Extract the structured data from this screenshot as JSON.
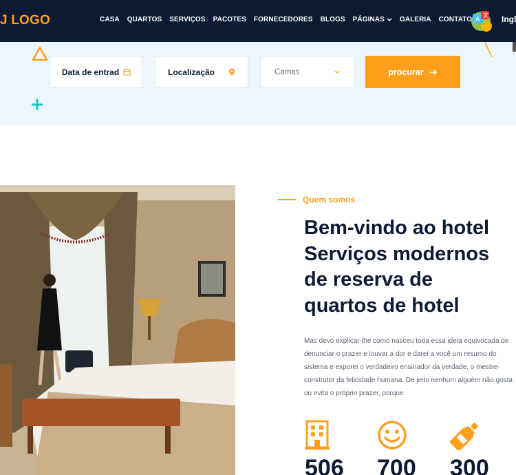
{
  "header": {
    "logo": "J LOGO",
    "nav": [
      {
        "label": "CASA"
      },
      {
        "label": "QUARTOS"
      },
      {
        "label": "SERVIÇOS"
      },
      {
        "label": "PACOTES"
      },
      {
        "label": "FORNECEDORES"
      },
      {
        "label": "BLOGS"
      },
      {
        "label": "PÁGINAS"
      },
      {
        "label": "GALERIA"
      },
      {
        "label": "CONTATO"
      }
    ],
    "language": "Ingl"
  },
  "booking": {
    "date_label": "Data de entrad",
    "location_label": "Localização",
    "beds_placeholder": "Camas",
    "search_label": "procurar"
  },
  "about": {
    "eyebrow": "Quem somos",
    "title_lines": [
      "Bem-vindo ao hotel",
      "Serviços modernos",
      "de reserva de",
      "quartos de hotel"
    ],
    "description": "Mas devo explicar-lhe como nasceu toda essa ideia equivocada de denunciar o prazer e louvar a dor e darei a você um resumo do sistema e exporei o verdadeiro ensinador da verdade, o mestre-construtor da felicidade humana. De jeito nenhum alguém não gosta ou evita o próprio prazer, porque"
  },
  "stats": [
    {
      "icon": "building-icon",
      "value": "506"
    },
    {
      "icon": "smiley-icon",
      "value": "700"
    },
    {
      "icon": "bottle-icon",
      "value": "300"
    }
  ],
  "colors": {
    "accent": "#ff9f1c",
    "navy": "#0d1a33",
    "band": "#eef6fd",
    "teal": "#17c3c7"
  }
}
